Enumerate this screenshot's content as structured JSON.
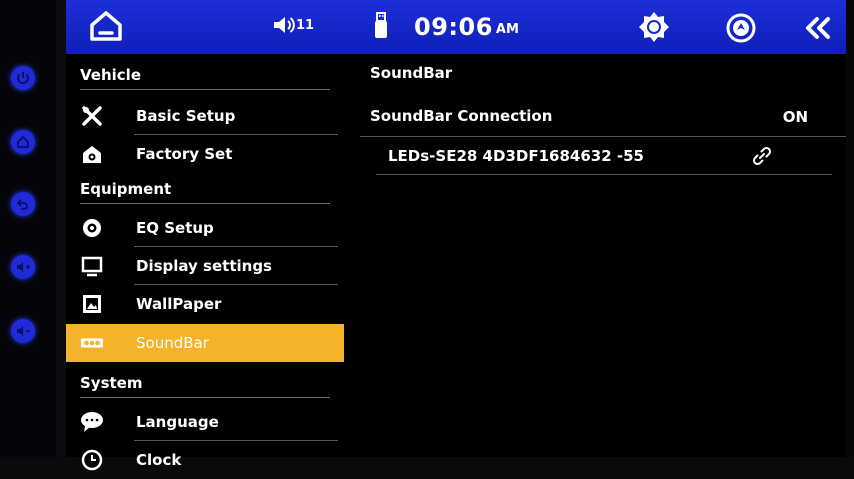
{
  "colors": {
    "status_bar": "#1a2bd4",
    "active_item": "#f3b32a",
    "hardware_button": "#1f2bd9",
    "background": "#000000"
  },
  "hardware_buttons": [
    {
      "icon": "power-icon"
    },
    {
      "icon": "home-icon"
    },
    {
      "icon": "back-icon"
    },
    {
      "icon": "volume-up-icon"
    },
    {
      "icon": "volume-down-icon"
    }
  ],
  "status_bar": {
    "volume_level": "11",
    "time": "09:06",
    "ampm": "AM",
    "icons": [
      "home-icon",
      "volume-icon",
      "usb-icon",
      "brightness-icon",
      "navigation-icon",
      "collapse-icon"
    ]
  },
  "sidebar": {
    "sections": [
      {
        "label": "Vehicle",
        "items": [
          {
            "label": "Basic Setup",
            "icon": "tools-icon"
          },
          {
            "label": "Factory Set",
            "icon": "factory-icon"
          }
        ]
      },
      {
        "label": "Equipment",
        "items": [
          {
            "label": "EQ Setup",
            "icon": "speaker-icon"
          },
          {
            "label": "Display settings",
            "icon": "monitor-icon"
          },
          {
            "label": "WallPaper",
            "icon": "wallpaper-icon"
          },
          {
            "label": "SoundBar",
            "icon": "soundbar-icon",
            "active": true
          }
        ]
      },
      {
        "label": "System",
        "items": [
          {
            "label": "Language",
            "icon": "chat-bubble-icon"
          },
          {
            "label": "Clock",
            "icon": "clock-icon"
          }
        ]
      }
    ]
  },
  "content": {
    "title": "SoundBar",
    "connection_label": "SoundBar Connection",
    "connection_value": "ON",
    "device_name": "LEDs-SE28 4D3DF1684632 -55",
    "device_icon": "link-icon"
  }
}
